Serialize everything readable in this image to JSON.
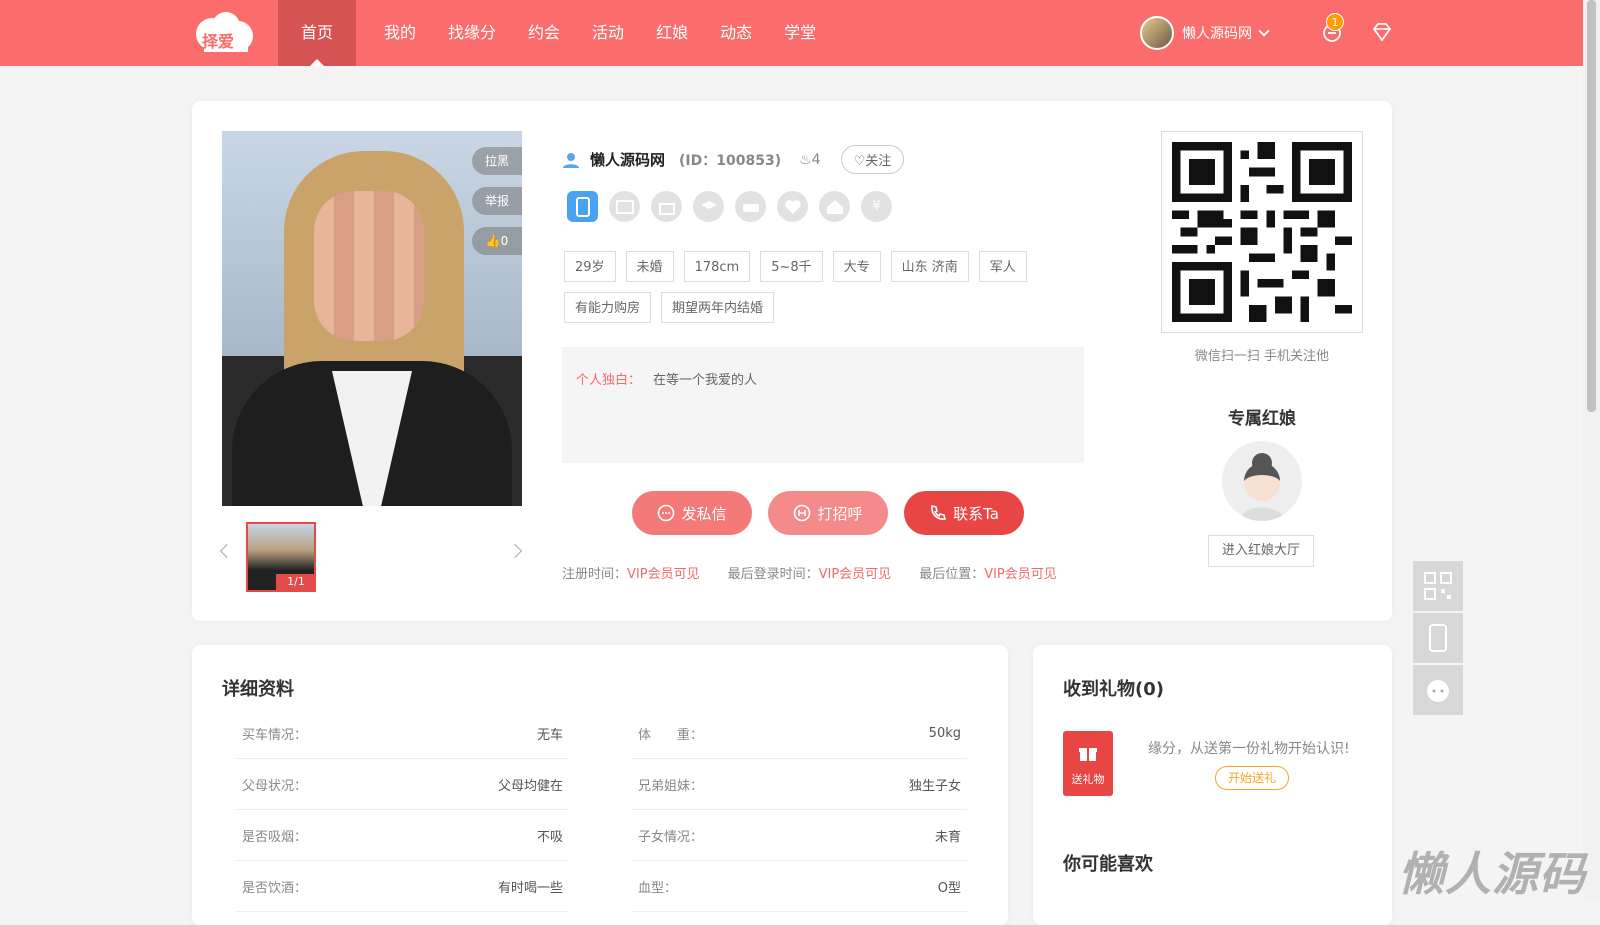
{
  "nav": {
    "logo_text": "择爱",
    "items": [
      {
        "label": "首页",
        "active": true
      },
      {
        "label": "我的"
      },
      {
        "label": "找缘分"
      },
      {
        "label": "约会"
      },
      {
        "label": "活动"
      },
      {
        "label": "红娘"
      },
      {
        "label": "动态"
      },
      {
        "label": "学堂"
      }
    ],
    "username": "懒人源码网",
    "notify_count": "1"
  },
  "photo": {
    "blacklist_label": "拉黑",
    "report_label": "举报",
    "likes_label": "0",
    "counter": "1/1"
  },
  "profile": {
    "name": "懒人源码网",
    "id_text": "(ID：100853)",
    "heat": "4",
    "follow_label": "关注",
    "verify_icons": [
      "phone-icon",
      "id-card-icon",
      "shop-icon",
      "education-icon",
      "car-icon",
      "marriage-icon",
      "house-icon",
      "income-icon"
    ],
    "tags": [
      "29岁",
      "未婚",
      "178cm",
      "5~8千",
      "大专",
      "山东 济南",
      "军人",
      "有能力购房",
      "期望两年内结婚"
    ],
    "monologue_label": "个人独白：",
    "monologue": "在等一个我爱的人",
    "actions": {
      "message": "发私信",
      "greet": "打招呼",
      "contact": "联系Ta"
    },
    "meta": [
      {
        "label": "注册时间：",
        "value": "VIP会员可见"
      },
      {
        "label": "最后登录时间：",
        "value": "VIP会员可见"
      },
      {
        "label": "最后位置：",
        "value": "VIP会员可见"
      }
    ]
  },
  "qr": {
    "caption": "微信扫一扫 手机关注他"
  },
  "matchmaker": {
    "title": "专属红娘",
    "button": "进入红娘大厅"
  },
  "details": {
    "title": "详细资料",
    "left": [
      {
        "label": "买车情况：",
        "value": "无车"
      },
      {
        "label": "父母状况：",
        "value": "父母均健在"
      },
      {
        "label": "是否吸烟：",
        "value": "不吸"
      },
      {
        "label": "是否饮酒：",
        "value": "有时喝一些"
      }
    ],
    "right": [
      {
        "label": "体　　重：",
        "value": "50kg"
      },
      {
        "label": "兄弟姐妹：",
        "value": "独生子女"
      },
      {
        "label": "子女情况：",
        "value": "未育"
      },
      {
        "label": "血型：",
        "value": "O型"
      }
    ]
  },
  "gifts": {
    "title": "收到礼物(0)",
    "send_label": "送礼物",
    "hint": "缘分，从送第一份礼物开始认识!",
    "start_button": "开始送礼"
  },
  "maybe_like": {
    "title": "你可能喜欢"
  },
  "watermark": "懒人源码",
  "colors": {
    "primary": "#fb6c6c",
    "accent": "#e84545"
  }
}
